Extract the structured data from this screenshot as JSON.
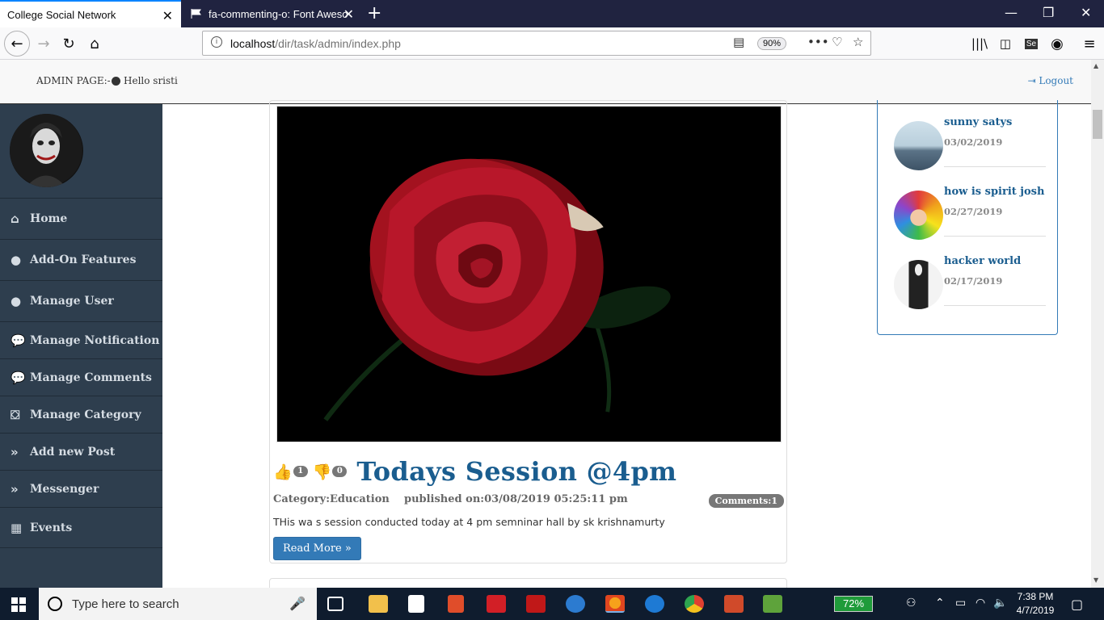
{
  "browser": {
    "tabs": [
      {
        "title": "College Social Network",
        "active": true
      },
      {
        "title": "fa-commenting-o: Font Aweso",
        "active": false
      }
    ],
    "url_host": "localhost",
    "url_path": "/dir/task/admin/index.php",
    "zoom": "90%"
  },
  "header": {
    "admin_label": "ADMIN PAGE:-",
    "greeting": "Hello sristi",
    "logout": "Logout"
  },
  "sidebar": {
    "items": [
      {
        "label": "Home",
        "icon": "home-icon"
      },
      {
        "label": "Add-On Features",
        "icon": "user-icon"
      },
      {
        "label": "Manage User",
        "icon": "user-icon"
      },
      {
        "label": "Manage Notification",
        "icon": "comments-icon"
      },
      {
        "label": "Manage Comments",
        "icon": "comments-icon"
      },
      {
        "label": "Manage Category",
        "icon": "category-icon"
      },
      {
        "label": "Add new Post",
        "icon": "double-chevron-down-icon"
      },
      {
        "label": "Messenger",
        "icon": "double-chevron-down-icon"
      },
      {
        "label": "Events",
        "icon": "calendar-icon"
      }
    ]
  },
  "post": {
    "likes": "1",
    "dislikes": "0",
    "title": "Todays Session @4pm",
    "category": "Category:Education",
    "published": "published on:03/08/2019 05:25:11 pm",
    "comments": "Comments:1",
    "body": "THis wa s session conducted today at 4 pm semninar hall by sk krishnamurty",
    "read_more": "Read More »"
  },
  "recent_posts": [
    {
      "title": "sunny satys",
      "date": "03/02/2019"
    },
    {
      "title": "how is spirit josh",
      "date": "02/27/2019"
    },
    {
      "title": "hacker world",
      "date": "02/17/2019"
    }
  ],
  "taskbar": {
    "search_placeholder": "Type here to search",
    "battery": "72%",
    "time": "7:38 PM",
    "date": "4/7/2019"
  },
  "colors": {
    "sidebar_bg": "#2e3e4e",
    "link_blue": "#337ab7",
    "title_blue": "#1a5d8f",
    "tabbar_bg": "#202340"
  }
}
